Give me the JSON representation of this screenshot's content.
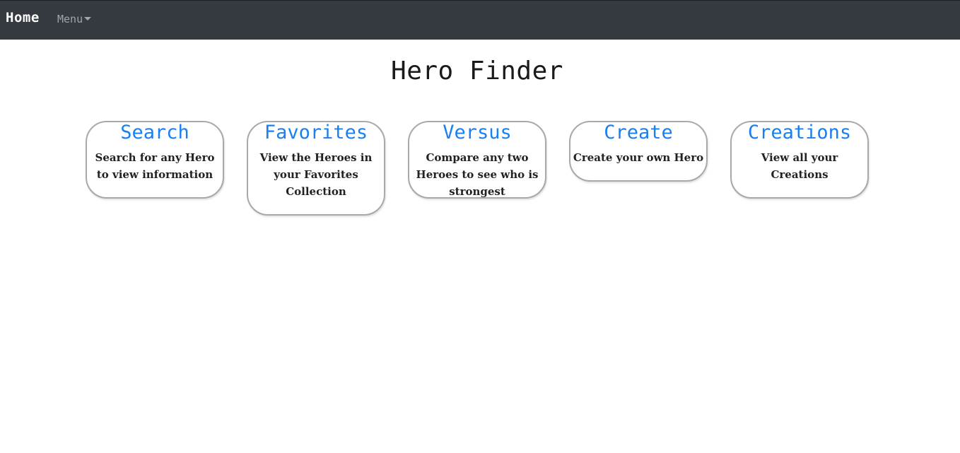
{
  "navbar": {
    "brand": "Home",
    "menu_label": "Menu"
  },
  "page": {
    "title": "Hero Finder"
  },
  "cards": [
    {
      "title": "Search",
      "description": "Search for any Hero to view information"
    },
    {
      "title": "Favorites",
      "description": "View the Heroes in your Favorites Collection"
    },
    {
      "title": "Versus",
      "description": "Compare any two Heroes to see who is strongest"
    },
    {
      "title": "Create",
      "description": "Create your own Hero"
    },
    {
      "title": "Creations",
      "description": "View all your Creations"
    }
  ],
  "colors": {
    "navbar_bg": "#343a40",
    "link": "#1a7ff0",
    "card_border": "#a9a9a9"
  }
}
